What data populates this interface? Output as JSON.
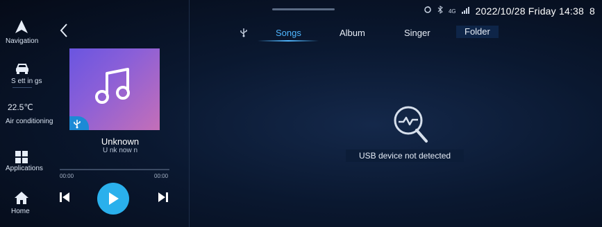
{
  "sidebar": {
    "navigation_label": "Navigation",
    "settings_label": "S ett in gs",
    "temperature": "22.5℃",
    "aircon_label": "Air conditioning",
    "applications_label": "Applications",
    "home_label": "Home"
  },
  "status_bar": {
    "network": "4G",
    "datetime": "2022/10/28 Friday 14:38",
    "battery_glyph": "8"
  },
  "player": {
    "title": "Unknown",
    "artist": "U nk now n",
    "time_elapsed": "00:00",
    "time_total": "00:00",
    "progress": 0
  },
  "tabs": [
    {
      "label": "Songs",
      "active": true
    },
    {
      "label": "Album",
      "active": false
    },
    {
      "label": "Singer",
      "active": false
    },
    {
      "label": "Folder",
      "active": false
    }
  ],
  "empty_state": {
    "message": "USB device not detected"
  },
  "colors": {
    "accent": "#4fb6ff",
    "play_button": "#2ab0ec",
    "background": "#050b18"
  }
}
